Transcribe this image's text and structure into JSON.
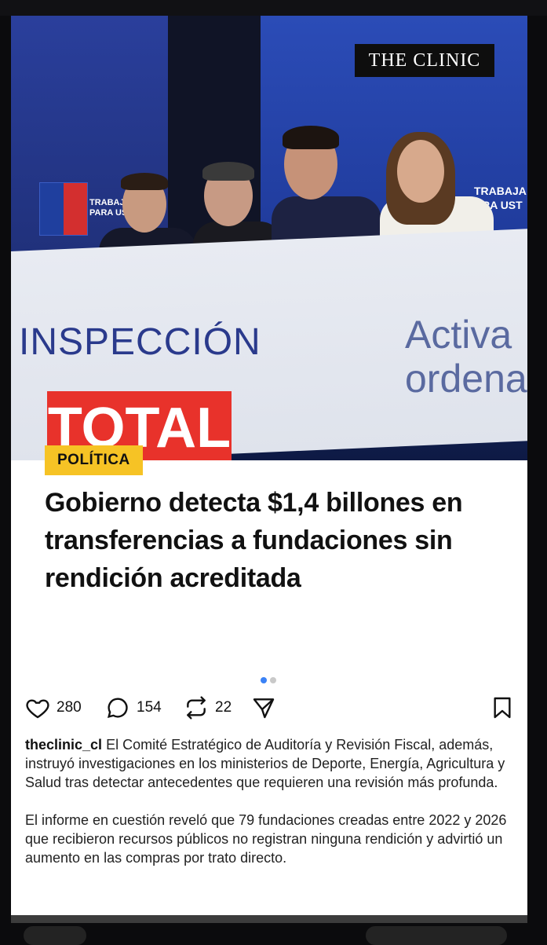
{
  "brand": {
    "logo_text": "THE CLINIC"
  },
  "photo": {
    "podium_text_1": "INSPECCIÓN",
    "podium_text_2": "TOTAL",
    "podium_text_3": "Activa",
    "podium_text_4": "ordena",
    "wall_label_left": "TRABAJA\nPARA UST",
    "wall_label_right": "TRABAJA\nARA UST"
  },
  "post": {
    "category": "POLÍTICA",
    "headline": "Gobierno detecta $1,4 billones en transferencias a fundaciones sin rendición acreditada",
    "carousel": {
      "active_index": 0,
      "count": 2
    },
    "likes": "280",
    "comments": "154",
    "reposts": "22",
    "username": "theclinic_cl",
    "caption_p1": "El Comité Estratégico de Auditoría y Revisión Fiscal, además, instruyó investigaciones en los ministerios de Deporte, Energía, Agricultura y Salud tras detectar antecedentes que requieren una revisión más profunda.",
    "caption_p2": "El informe en cuestión reveló que 79 fundaciones creadas entre 2022 y 2026 que recibieron recursos públicos no registran ninguna rendición y advirtió un aumento en las compras por trato directo."
  },
  "colors": {
    "tag_bg": "#f6c325",
    "dot_active": "#3b82f6",
    "dot_inactive": "#c9c9c9"
  },
  "icons": [
    "heart-icon",
    "comment-icon",
    "repost-icon",
    "share-icon",
    "bookmark-icon"
  ]
}
